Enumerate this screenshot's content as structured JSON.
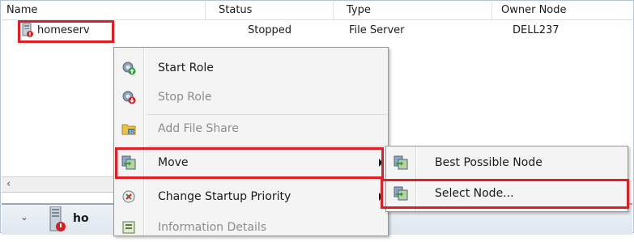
{
  "columns": {
    "name": "Name",
    "status": "Status",
    "type": "Type",
    "owner": "Owner Node"
  },
  "row": {
    "name": "homeserv",
    "status": "Stopped",
    "type": "File Server",
    "owner": "DELL237"
  },
  "context_menu": {
    "items": [
      {
        "label": "Start Role",
        "enabled": true,
        "icon": "start-role-icon"
      },
      {
        "label": "Stop Role",
        "enabled": false,
        "icon": "stop-role-icon"
      },
      {
        "label": "Add File Share",
        "enabled": false,
        "icon": "add-file-share-icon"
      },
      {
        "label": "Move",
        "enabled": true,
        "icon": "move-icon",
        "submenu": true
      },
      {
        "label": "Change Startup Priority",
        "enabled": true,
        "icon": "priority-icon",
        "submenu": true
      },
      {
        "label": "Information Details",
        "enabled": false,
        "icon": "info-icon"
      }
    ]
  },
  "move_submenu": {
    "items": [
      {
        "label": "Best Possible Node",
        "icon": "move-node-icon"
      },
      {
        "label": "Select Node...",
        "icon": "move-node-icon"
      }
    ]
  },
  "scroll": {
    "left_arrow": "‹"
  },
  "details": {
    "name": "ho",
    "chevron": "⌄"
  },
  "colors": {
    "highlight": "#e31d24",
    "menu_bg": "#f4f4f4",
    "header_border": "#dbe2ea"
  }
}
